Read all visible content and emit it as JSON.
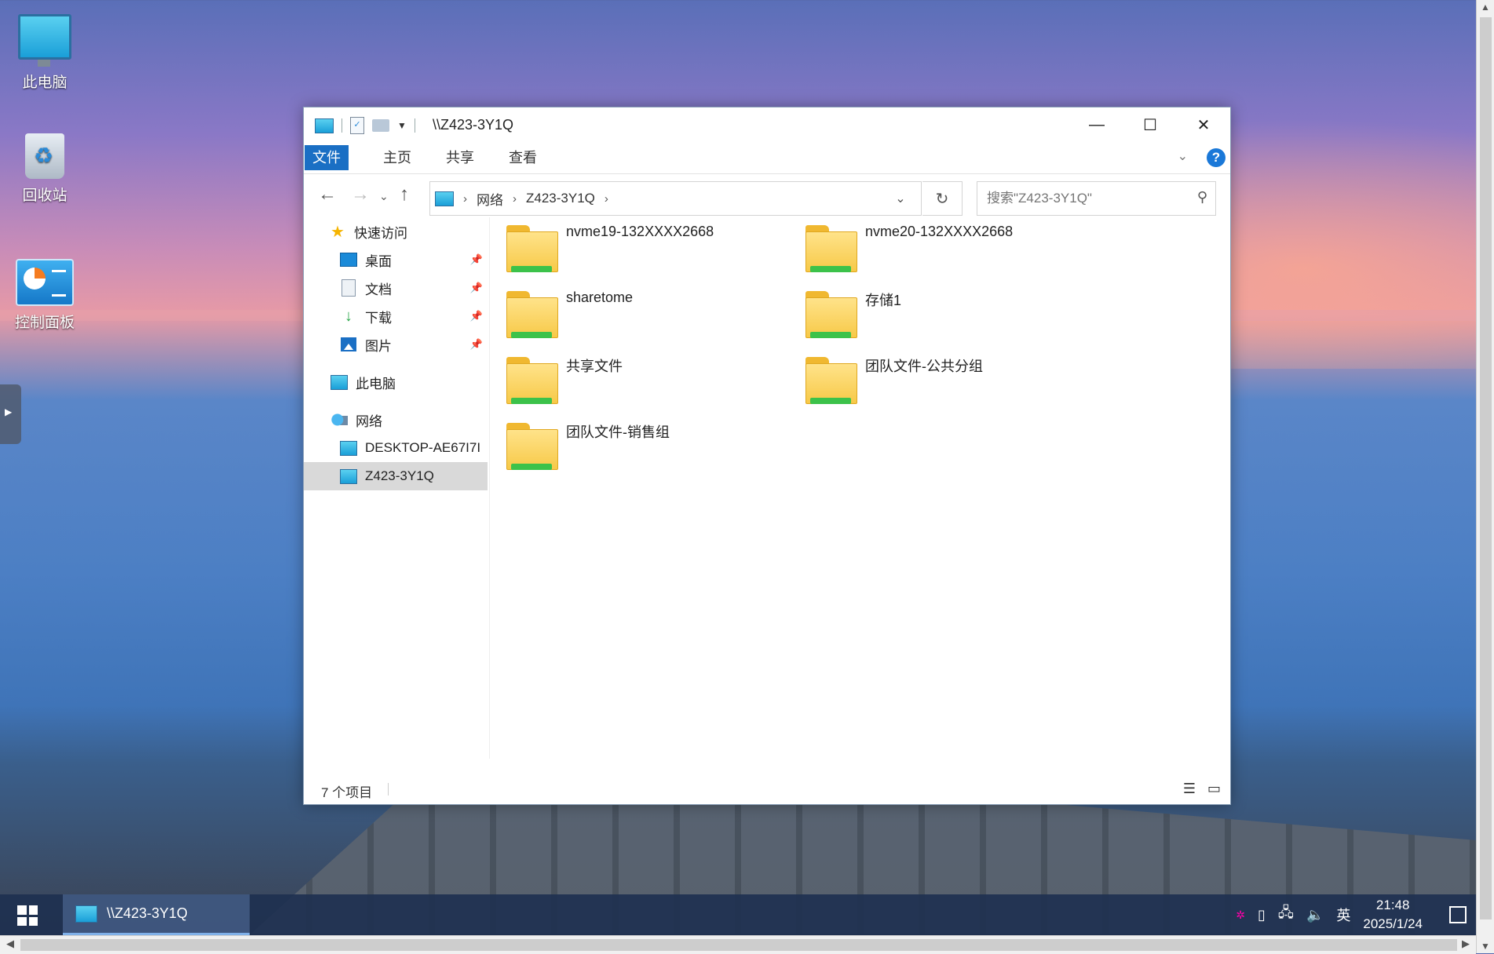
{
  "desktop": {
    "icons": [
      {
        "label": "此电脑",
        "icon": "monitor-icon"
      },
      {
        "label": "回收站",
        "icon": "recycle-bin-icon"
      },
      {
        "label": "控制面板",
        "icon": "control-panel-icon"
      }
    ]
  },
  "window": {
    "title": "\\\\Z423-3Y1Q",
    "ribbon_tabs": [
      "文件",
      "主页",
      "共享",
      "查看"
    ],
    "address": {
      "crumbs": [
        "网络",
        "Z423-3Y1Q"
      ]
    },
    "search": {
      "placeholder": "搜索\"Z423-3Y1Q\""
    },
    "nav_pane": {
      "quick_access": "快速访问",
      "quick_items": [
        {
          "label": "桌面",
          "icon": "desktop-icon"
        },
        {
          "label": "文档",
          "icon": "document-icon"
        },
        {
          "label": "下载",
          "icon": "download-icon"
        },
        {
          "label": "图片",
          "icon": "pictures-icon"
        }
      ],
      "this_pc": "此电脑",
      "network": "网络",
      "network_items": [
        "DESKTOP-AE67I7I",
        "Z423-3Y1Q"
      ]
    },
    "folders": [
      "nvme19-132XXXX2668",
      "nvme20-132XXXX2668",
      "sharetome",
      "存储1",
      "共享文件",
      "团队文件-公共分组",
      "团队文件-销售组"
    ],
    "status": {
      "count": "7 个项目"
    }
  },
  "taskbar": {
    "app_label": "\\\\Z423-3Y1Q",
    "ime": "英",
    "time": "21:48",
    "date": "2025/1/24"
  },
  "colors": {
    "accent": "#1a6fc4",
    "folder": "#f7c948",
    "share_bar": "#3cc24a",
    "taskbar": "#1e3050"
  }
}
